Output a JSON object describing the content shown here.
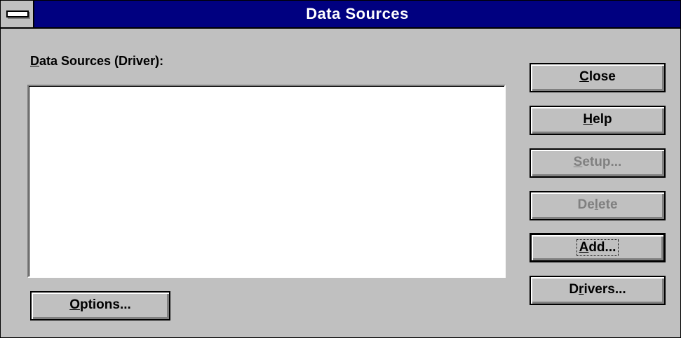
{
  "window": {
    "title": "Data Sources",
    "system_menu_icon": "system-menu-icon"
  },
  "list": {
    "label_mnemonic": "D",
    "label_rest": "ata Sources (Driver):",
    "items": []
  },
  "buttons": {
    "close": {
      "pre": "",
      "mnemonic": "C",
      "post": "lose",
      "enabled": true
    },
    "help": {
      "pre": "",
      "mnemonic": "H",
      "post": "elp",
      "enabled": true
    },
    "setup": {
      "pre": "",
      "mnemonic": "S",
      "post": "etup...",
      "enabled": false
    },
    "delete": {
      "pre": "De",
      "mnemonic": "l",
      "post": "ete",
      "enabled": false
    },
    "add": {
      "pre": "",
      "mnemonic": "A",
      "post": "dd...",
      "enabled": true,
      "focused": true
    },
    "drivers": {
      "pre": "D",
      "mnemonic": "r",
      "post": "ivers...",
      "enabled": true
    },
    "options": {
      "pre": "",
      "mnemonic": "O",
      "post": "ptions...",
      "enabled": true
    }
  },
  "colors": {
    "title_bar": "#000080",
    "face": "#c0c0c0",
    "disabled_text": "#808080"
  }
}
